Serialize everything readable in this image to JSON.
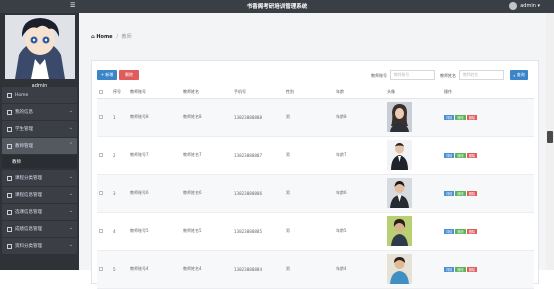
{
  "header": {
    "title": "书香阁考研培训管理系统",
    "user": "admin ▾",
    "menu_icon": "menu-toggle-icon"
  },
  "sidebar": {
    "admin_name": "admin",
    "items": [
      {
        "label": "Home",
        "icon": "home-icon"
      },
      {
        "label": "我的信息",
        "icon": "user-icon"
      },
      {
        "label": "学生管理",
        "icon": "heart-icon"
      },
      {
        "label": "教师管理",
        "icon": "teacher-icon"
      },
      {
        "label": "教师",
        "icon": ""
      },
      {
        "label": "课程分类管理",
        "icon": "mail-icon"
      },
      {
        "label": "课程信息管理",
        "icon": "grid-icon"
      },
      {
        "label": "选课信息管理",
        "icon": "grid-icon"
      },
      {
        "label": "成绩信息管理",
        "icon": "grid-icon"
      },
      {
        "label": "资料分类管理",
        "icon": "grid-icon"
      }
    ]
  },
  "breadcrumb": {
    "home": "Home",
    "separator": "/",
    "current": "教师"
  },
  "toolbar": {
    "add_label": "+ 新增",
    "delete_label": "删除",
    "filter1_label": "教师账号",
    "filter1_placeholder": "教师账号",
    "filter2_label": "教师姓名",
    "filter2_placeholder": "教师姓名",
    "search_label": "查询"
  },
  "table": {
    "headers": [
      "",
      "序号",
      "教师账号",
      "教师姓名",
      "手机号",
      "性别",
      "年龄",
      "头像",
      "操作"
    ],
    "rows": [
      {
        "index": "1",
        "account": "教师账号8",
        "name": "教师姓名8",
        "phone": "13823888888",
        "gender": "男",
        "age": "年龄8"
      },
      {
        "index": "2",
        "account": "教师账号7",
        "name": "教师姓名7",
        "phone": "13823888887",
        "gender": "男",
        "age": "年龄7"
      },
      {
        "index": "3",
        "account": "教师账号6",
        "name": "教师姓名6",
        "phone": "13823888886",
        "gender": "男",
        "age": "年龄6"
      },
      {
        "index": "4",
        "account": "教师账号5",
        "name": "教师姓名5",
        "phone": "13823888885",
        "gender": "男",
        "age": "年龄5"
      },
      {
        "index": "5",
        "account": "教师账号4",
        "name": "教师姓名4",
        "phone": "13823888884",
        "gender": "男",
        "age": "年龄4"
      }
    ],
    "ops": {
      "detail": "详情",
      "edit": "修改",
      "remove": "删除"
    }
  },
  "colors": {
    "primary": "#3a86c8",
    "danger": "#e05b5b",
    "success": "#5cb35c",
    "sidebar": "#2f3237",
    "topbar": "#3a3f45"
  }
}
